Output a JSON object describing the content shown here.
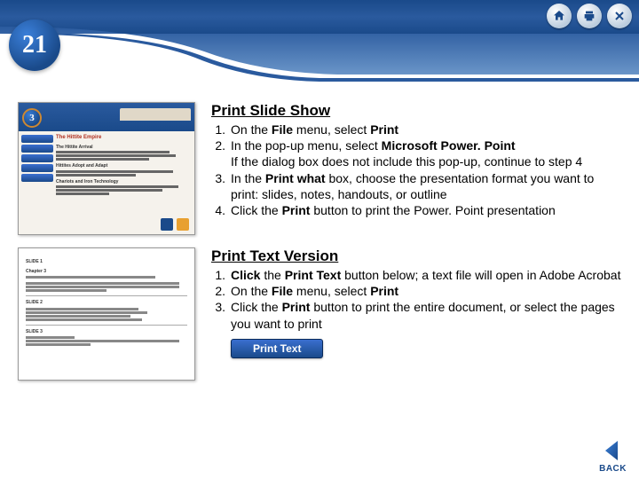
{
  "chapter": {
    "number": "21"
  },
  "header": {
    "icons": {
      "home": "home-icon",
      "print": "print-icon",
      "close": "close-icon"
    }
  },
  "slideThumb": {
    "badge": "3",
    "title": "The Hittite Empire",
    "sub1": "The Hittite Arrival",
    "pts1": [
      "Hittites: group of Indo-European speakers",
      "Took control of Anatolia (Asia Minor) around 2000 B.C.",
      "City-states joined; empire dominates Southwest Asia for 450 years"
    ],
    "sub2": "Hittites Adopt and Adapt",
    "pts2": [
      "Borrowed ideas from Mesopotamian culture; adopted Babylonian language",
      "Made own laws"
    ],
    "sub3": "Chariots and Iron Technology",
    "pts3": [
      "Hittites excelled in war; spread iron technology by trade and conquest",
      "Empire falls around 1190 B.C. after attacks from northern tribes"
    ]
  },
  "textThumb": {
    "h1": "SLIDE 1",
    "h1b": "Chapter 3",
    "line1": "People and Ideas on the Move, 2000 B.C.–250 B.C.",
    "para": "Migrations by Indo-Europeans led to major changes in race and language as well as the foundations of three religions: Hinduism, Buddhism, and Judaism.",
    "h2": "SLIDE 2",
    "s1": "Section 1: The Indo-Europeans",
    "s2": "Section 2: Hinduism and Buddhism",
    "s3": "Section 3: Seafaring Traders",
    "s4": "Section 4: The Origins of Judaism",
    "h3": "SLIDE 3",
    "s5": "Section 1",
    "line2": "Indo-Europeans migrate into Europe, India, and Southwest Asia and interact with peoples living there"
  },
  "section1": {
    "title": "Print Slide Show",
    "steps": [
      {
        "n": "1.",
        "t": "On the <b>File</b> menu, select <b>Print</b>"
      },
      {
        "n": "2.",
        "t": "In the pop-up menu, select <b>Microsoft Power. Point</b>"
      },
      {
        "n": "",
        "t": "If the dialog box does not include this pop-up, continue to step 4"
      },
      {
        "n": "3.",
        "t": "In the <b>Print what</b> box, choose the presentation format you want to print: slides, notes, handouts, or outline"
      },
      {
        "n": "4.",
        "t": "Click the <b>Print</b> button to print the Power. Point presentation"
      }
    ]
  },
  "section2": {
    "title": "Print Text Version",
    "steps": [
      {
        "n": "1.",
        "t": "<b>Click</b> the <b>Print Text</b> button below; a text file will open in  Adobe Acrobat"
      },
      {
        "n": "2.",
        "t": "On the <b>File</b> menu, select <b>Print</b>"
      },
      {
        "n": "3.",
        "t": "Click the <b>Print</b> button to print the entire document, or select the pages you want to print"
      }
    ],
    "button": "Print Text"
  },
  "back": {
    "label": "BACK"
  }
}
